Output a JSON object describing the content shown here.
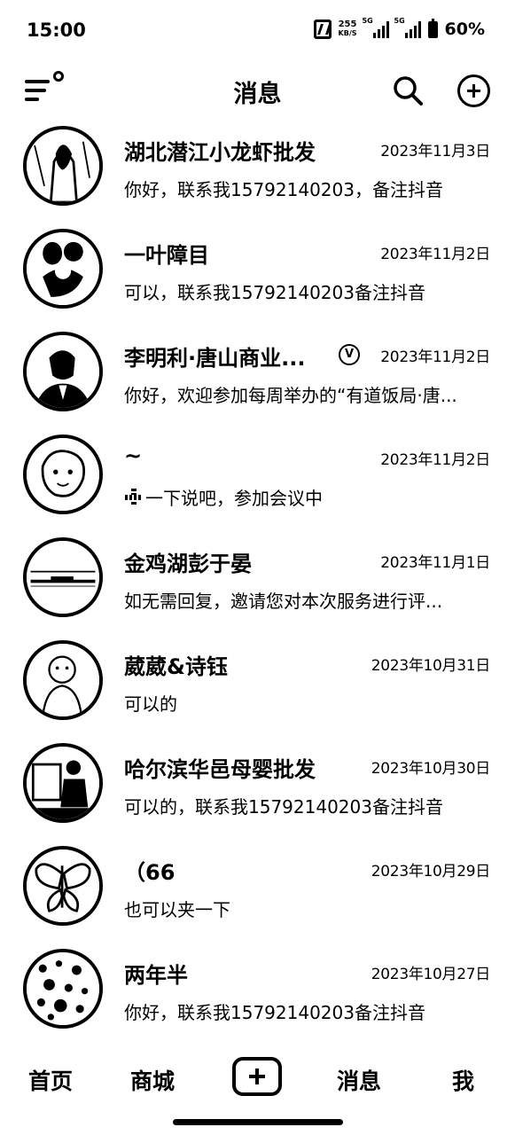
{
  "status_bar": {
    "time": "15:00",
    "net_speed_value": "255",
    "net_speed_unit": "KB/S",
    "signal1_tag": "5G",
    "signal2_tag": "5G",
    "battery": "60%"
  },
  "header": {
    "title": "消息",
    "icons": [
      "menu-icon",
      "search-icon",
      "add-circle-icon"
    ]
  },
  "conversations": [
    {
      "name": "湖北潜江小龙虾批发",
      "date": "2023年11月3日",
      "preview": "你好，联系我15792140203，备注抖音"
    },
    {
      "name": "一叶障目",
      "date": "2023年11月2日",
      "preview": "可以，联系我15792140203备注抖音"
    },
    {
      "name": "李明利·唐山商业...",
      "date": "2023年11月2日",
      "preview": "你好，欢迎参加每周举办的“有道饭局·唐...",
      "verified_badge": "V"
    },
    {
      "name": "~",
      "date": "2023年11月2日",
      "preview": "一下说吧，参加会议中"
    },
    {
      "name": "金鸡湖彭于晏",
      "date": "2023年11月1日",
      "preview": "如无需回复，邀请您对本次服务进行评..."
    },
    {
      "name": "葳葳&诗钰",
      "date": "2023年10月31日",
      "preview": "可以的"
    },
    {
      "name": "哈尔滨华邑母婴批发",
      "date": "2023年10月30日",
      "preview": "可以的，联系我15792140203备注抖音"
    },
    {
      "name": "（66",
      "date": "2023年10月29日",
      "preview": "也可以夹一下"
    },
    {
      "name": "两年半",
      "date": "2023年10月27日",
      "preview": "你好，联系我15792140203备注抖音"
    }
  ],
  "tabbar": {
    "home": "首页",
    "mall": "商城",
    "messages": "消息",
    "me": "我"
  }
}
